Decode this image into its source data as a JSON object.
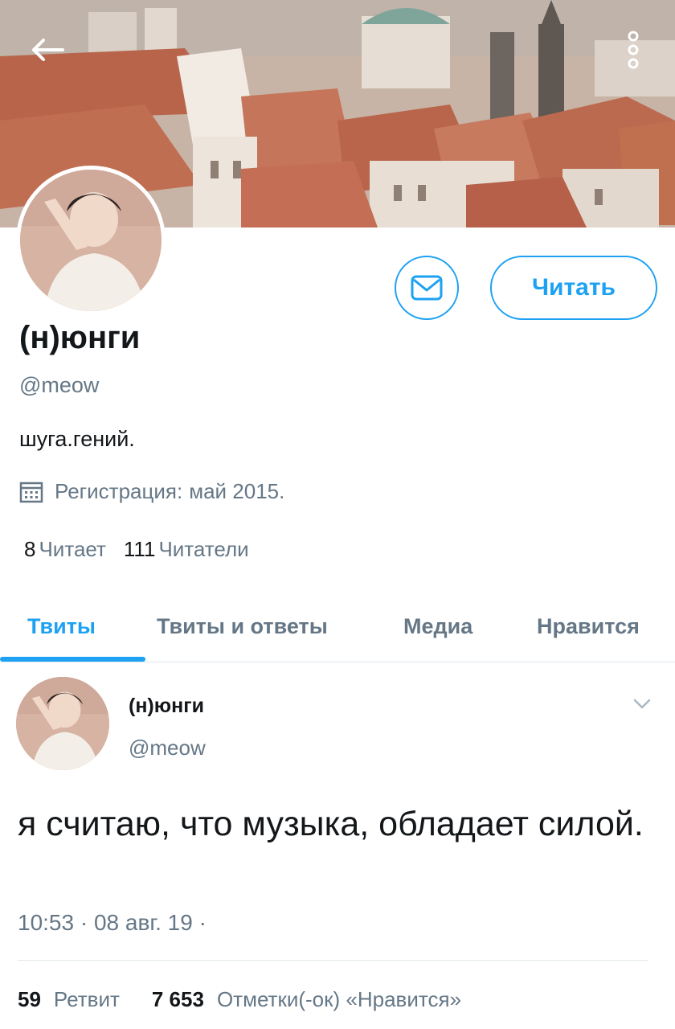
{
  "header": {
    "back_icon": "arrow-left-icon",
    "more_icon": "more-vertical-icon"
  },
  "profile": {
    "name": "(н)юнги",
    "handle": "@meow",
    "bio": "шуга.гений.",
    "joined_label": "Регистрация:",
    "joined_date": "май 2015.",
    "message_icon": "mail-icon",
    "follow_label": "Читать",
    "following_count": "8",
    "following_label": "Читает",
    "followers_count": "111",
    "followers_label": "Читатели"
  },
  "tabs": [
    {
      "label": "Твиты",
      "active": true
    },
    {
      "label": "Твиты и ответы",
      "active": false
    },
    {
      "label": "Медиа",
      "active": false
    },
    {
      "label": "Нравится",
      "active": false
    }
  ],
  "tweet": {
    "author_name": "(н)юнги",
    "author_handle": "@meow",
    "text": "я считаю, что музыка, обладает силой.",
    "time": "10:53 · 08 авг. 19 ·",
    "retweet_count": "59",
    "retweet_label": "Ретвит",
    "like_count": "7 653",
    "like_label": "Отметки(-ок) «Нравится»"
  },
  "colors": {
    "accent": "#1da1f2",
    "text_primary": "#14171a",
    "text_secondary": "#657786",
    "divider": "#e1e8ed"
  }
}
